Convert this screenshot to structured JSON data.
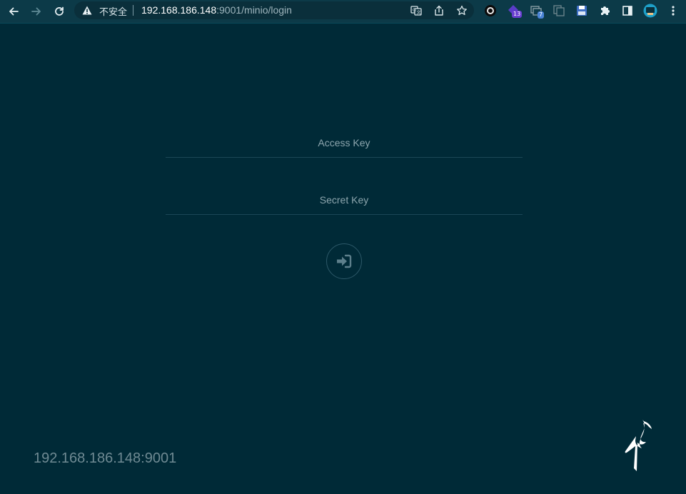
{
  "browser": {
    "security_label": "不安全",
    "url_host": "192.168.186.148",
    "url_rest": ":9001/minio/login",
    "extensions": [
      {
        "name": "circle-extension-icon"
      },
      {
        "name": "purple-extension-icon",
        "badge": "13",
        "badge_color": "#6a3fd1"
      },
      {
        "name": "tabs-extension-icon",
        "badge": "7",
        "badge_color": "#4a84d6"
      },
      {
        "name": "copy-extension-icon"
      },
      {
        "name": "save-extension-icon"
      },
      {
        "name": "puzzle-icon"
      },
      {
        "name": "sidepanel-icon"
      },
      {
        "name": "profile-avatar"
      }
    ]
  },
  "login": {
    "access_key_placeholder": "Access Key",
    "secret_key_placeholder": "Secret Key"
  },
  "footer": {
    "host": "192.168.186.148:9001"
  },
  "colors": {
    "background": "#002a37",
    "toolbar": "#0c3a48",
    "muted_text": "#8da6ae"
  }
}
